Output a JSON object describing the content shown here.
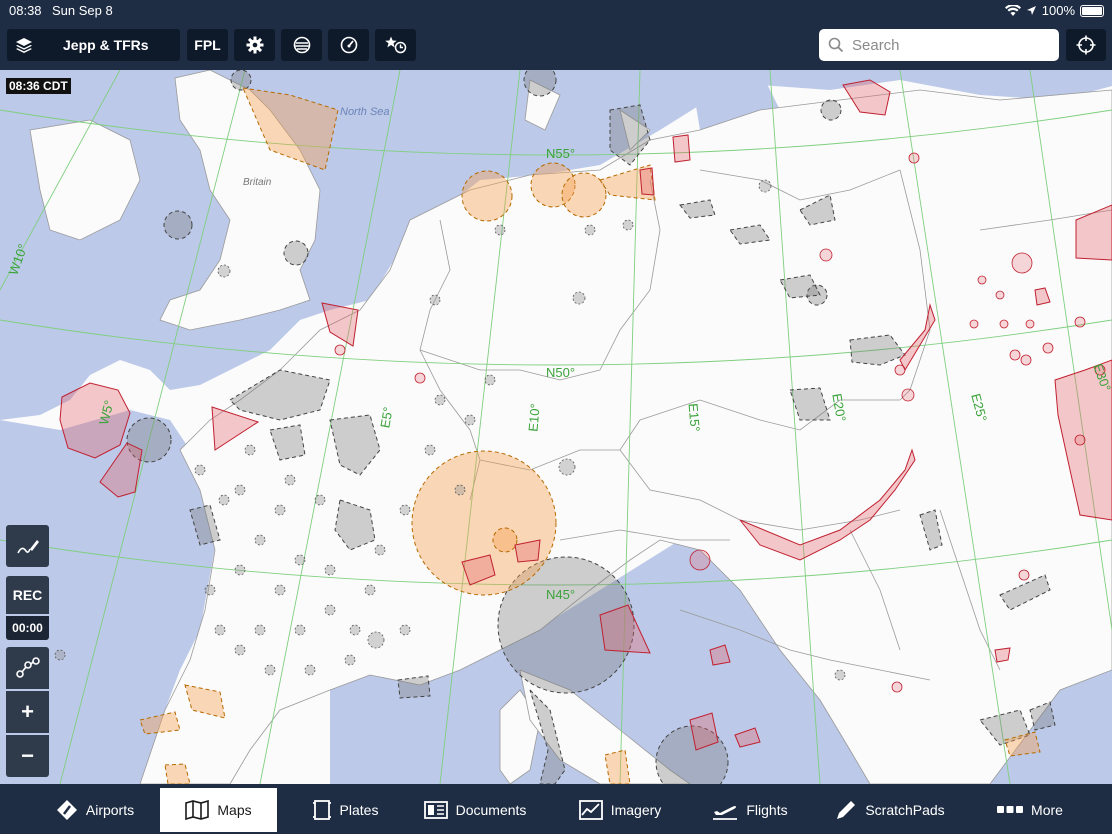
{
  "status": {
    "time": "08:38",
    "date": "Sun Sep 8",
    "battery": "100%"
  },
  "toolbar": {
    "layer_label": "Jepp & TFRs",
    "fpl_label": "FPL",
    "search_placeholder": "Search"
  },
  "map": {
    "timestamp": "08:36 CDT",
    "labels": {
      "n55": "N55°",
      "n50": "N50°",
      "n45": "N45°",
      "w10": "W10°",
      "w5": "W5°",
      "e5": "E5°",
      "e10": "E10°",
      "e15": "E15°",
      "e20": "E20°",
      "e25": "E25°",
      "e30": "E30°",
      "north_sea": "North Sea",
      "britain": "Britain"
    }
  },
  "side": {
    "rec_label": "REC",
    "timer": "00:00",
    "zoom_in": "+",
    "zoom_out": "−"
  },
  "tabs": [
    {
      "label": "Airports"
    },
    {
      "label": "Maps"
    },
    {
      "label": "Plates"
    },
    {
      "label": "Documents"
    },
    {
      "label": "Imagery"
    },
    {
      "label": "Flights"
    },
    {
      "label": "ScratchPads"
    },
    {
      "label": "More"
    }
  ]
}
